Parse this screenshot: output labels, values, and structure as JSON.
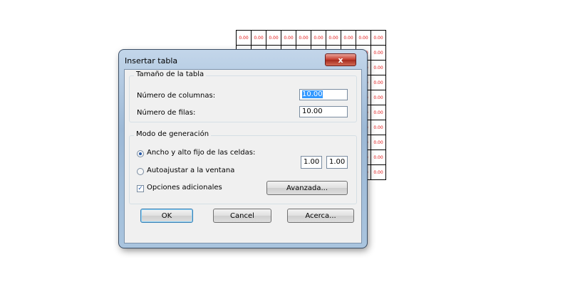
{
  "background_table": {
    "cell_value": "0.00",
    "rows": 10,
    "cols": 10
  },
  "dialog": {
    "title": "Insertar tabla",
    "close_label": "x",
    "size_group": {
      "label": "Tamaño de la tabla",
      "columns_label": "Número de columnas:",
      "columns_value": "10.00",
      "rows_label": "Número de filas:",
      "rows_value": "10.00"
    },
    "mode_group": {
      "label": "Modo de generación",
      "fixed_label": "Ancho y alto fijo de las celdas:",
      "fixed_selected": true,
      "autofit_label": "Autoajustar a la ventana",
      "autofit_selected": false,
      "width_value": "1.00",
      "height_value": "1.00",
      "options_label": "Opciones adicionales",
      "options_checked": true,
      "advanced_label": "Avanzada..."
    },
    "buttons": {
      "ok": "OK",
      "cancel": "Cancel",
      "about": "Acerca..."
    }
  }
}
